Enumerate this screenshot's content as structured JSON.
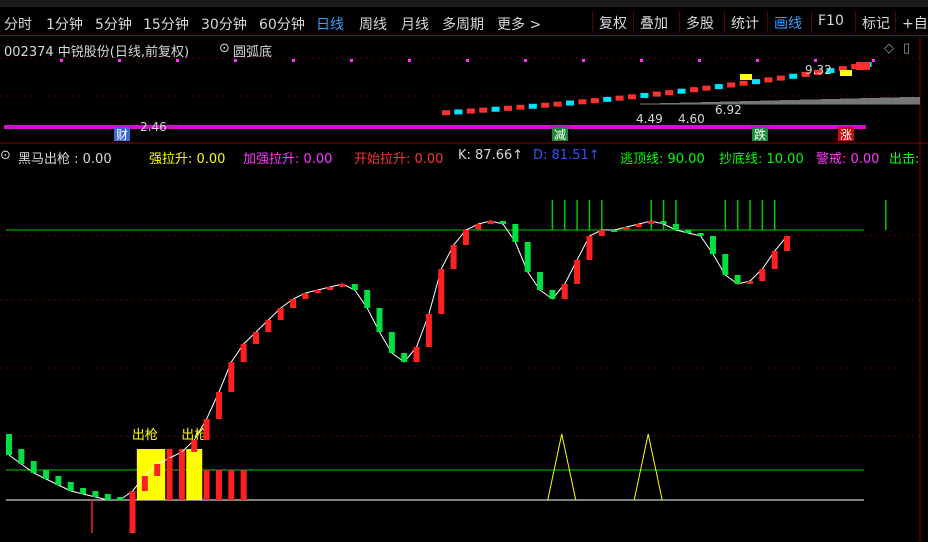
{
  "periods": [
    "分时",
    "1分钟",
    "5分钟",
    "15分钟",
    "30分钟",
    "60分钟",
    "日线",
    "周线",
    "月线",
    "多周期",
    "更多 >"
  ],
  "active_period": 6,
  "tools": [
    "复权",
    "叠加",
    "多股",
    "统计",
    "画线",
    "F10",
    "标记",
    "+自选"
  ],
  "active_tool": 4,
  "stock": {
    "code_name": "002374 中锐股份(日线,前复权)",
    "indicator_name": "圆弧底"
  },
  "main_chart": {
    "price_labels": [
      "9.32",
      "2.46",
      "4.49",
      "4.60",
      "6.92"
    ],
    "event_markers": [
      {
        "label": "财",
        "color": "#3a6ad8"
      },
      {
        "label": "减",
        "color": "#1e8a3a"
      },
      {
        "label": "跌",
        "color": "#1e8a3a"
      },
      {
        "label": "涨",
        "color": "#c01010"
      }
    ]
  },
  "indicator": {
    "name": "黑马出枪",
    "params": [
      {
        "label": "黑马出枪 : 0.00",
        "color": "#d8d8d8"
      },
      {
        "label": "强拉升: 0.00",
        "color": "#ffff00"
      },
      {
        "label": "加强拉升: 0.00",
        "color": "#ff33ff"
      },
      {
        "label": "开始拉升: 0.00",
        "color": "#ff3333"
      },
      {
        "label": "K: 87.66↑",
        "color": "#d8d8d8"
      },
      {
        "label": "D: 81.51↑",
        "color": "#3355ff"
      },
      {
        "label": "逃顶线: 90.00",
        "color": "#00ff00"
      },
      {
        "label": "抄底线: 10.00",
        "color": "#00ff00"
      },
      {
        "label": "警戒: 0.00",
        "color": "#ff33ff"
      },
      {
        "label": "出击:",
        "color": "#00ff00"
      }
    ],
    "signal_labels": [
      "出枪",
      "出枪"
    ]
  },
  "chart_data": {
    "type": "bar",
    "title": "黑马出枪",
    "reference_lines": {
      "逃顶线": 90,
      "抄底线": 10,
      "zero": 0
    },
    "k_series": [
      {
        "c": 15,
        "o": 22,
        "up": false
      },
      {
        "c": 12,
        "o": 17,
        "up": false
      },
      {
        "c": 9,
        "o": 13,
        "up": false
      },
      {
        "c": 7,
        "o": 10,
        "up": false
      },
      {
        "c": 5,
        "o": 8,
        "up": false
      },
      {
        "c": 3,
        "o": 6,
        "up": false
      },
      {
        "c": 2,
        "o": 4,
        "up": false
      },
      {
        "c": 1,
        "o": 3,
        "up": false
      },
      {
        "c": 0,
        "o": 2,
        "up": false
      },
      {
        "c": 0,
        "o": 1,
        "up": false
      },
      {
        "c": 3,
        "o": 0,
        "up": true
      },
      {
        "c": 8,
        "o": 3,
        "up": true
      },
      {
        "c": 12,
        "o": 8,
        "up": true
      },
      {
        "c": 14,
        "o": 12,
        "up": true
      },
      {
        "c": 16,
        "o": 14,
        "up": true
      },
      {
        "c": 20,
        "o": 16,
        "up": true
      },
      {
        "c": 27,
        "o": 20,
        "up": true
      },
      {
        "c": 36,
        "o": 27,
        "up": true
      },
      {
        "c": 46,
        "o": 36,
        "up": true
      },
      {
        "c": 52,
        "o": 46,
        "up": true
      },
      {
        "c": 56,
        "o": 52,
        "up": true
      },
      {
        "c": 60,
        "o": 56,
        "up": true
      },
      {
        "c": 64,
        "o": 60,
        "up": true
      },
      {
        "c": 67,
        "o": 64,
        "up": true
      },
      {
        "c": 69,
        "o": 67,
        "up": true
      },
      {
        "c": 70,
        "o": 69,
        "up": true
      },
      {
        "c": 71,
        "o": 70,
        "up": true
      },
      {
        "c": 72,
        "o": 71,
        "up": true
      },
      {
        "c": 70,
        "o": 72,
        "up": false
      },
      {
        "c": 64,
        "o": 70,
        "up": false
      },
      {
        "c": 56,
        "o": 64,
        "up": false
      },
      {
        "c": 49,
        "o": 56,
        "up": false
      },
      {
        "c": 46,
        "o": 49,
        "up": false
      },
      {
        "c": 51,
        "o": 46,
        "up": true
      },
      {
        "c": 62,
        "o": 51,
        "up": true
      },
      {
        "c": 77,
        "o": 62,
        "up": true
      },
      {
        "c": 85,
        "o": 77,
        "up": true
      },
      {
        "c": 90,
        "o": 85,
        "up": true
      },
      {
        "c": 92,
        "o": 90,
        "up": true
      },
      {
        "c": 93,
        "o": 92,
        "up": true
      },
      {
        "c": 92,
        "o": 93,
        "up": false
      },
      {
        "c": 86,
        "o": 92,
        "up": false
      },
      {
        "c": 76,
        "o": 86,
        "up": false
      },
      {
        "c": 70,
        "o": 76,
        "up": false
      },
      {
        "c": 67,
        "o": 70,
        "up": false
      },
      {
        "c": 72,
        "o": 67,
        "up": true
      },
      {
        "c": 80,
        "o": 72,
        "up": true
      },
      {
        "c": 88,
        "o": 80,
        "up": true
      },
      {
        "c": 90,
        "o": 88,
        "up": true
      },
      {
        "c": 90,
        "o": 90,
        "up": false
      },
      {
        "c": 91,
        "o": 90,
        "up": true
      },
      {
        "c": 92,
        "o": 91,
        "up": true
      },
      {
        "c": 93,
        "o": 92,
        "up": true
      },
      {
        "c": 92,
        "o": 93,
        "up": false
      },
      {
        "c": 90,
        "o": 92,
        "up": false
      },
      {
        "c": 89,
        "o": 90,
        "up": false
      },
      {
        "c": 88,
        "o": 89,
        "up": false
      },
      {
        "c": 82,
        "o": 88,
        "up": false
      },
      {
        "c": 75,
        "o": 82,
        "up": false
      },
      {
        "c": 72,
        "o": 75,
        "up": false
      },
      {
        "c": 73,
        "o": 72,
        "up": true
      },
      {
        "c": 77,
        "o": 73,
        "up": true
      },
      {
        "c": 83,
        "o": 77,
        "up": true
      },
      {
        "c": 88,
        "o": 83,
        "up": true
      }
    ],
    "signal_bars": [
      {
        "i": 10,
        "v": -11,
        "color": "#ff2020"
      },
      {
        "i": 11,
        "v": 17,
        "color": "#ffff00"
      },
      {
        "i": 12,
        "v": 17,
        "color": "#ffff00"
      },
      {
        "i": 13,
        "v": 17,
        "color": "#ff2020"
      },
      {
        "i": 14,
        "v": 17,
        "color": "#ff2020"
      },
      {
        "i": 15,
        "v": 17,
        "color": "#ffff00"
      },
      {
        "i": 16,
        "v": 10,
        "color": "#ff2020"
      },
      {
        "i": 17,
        "v": 10,
        "color": "#ff2020"
      },
      {
        "i": 18,
        "v": 10,
        "color": "#ff2020"
      },
      {
        "i": 19,
        "v": 10,
        "color": "#ff2020"
      }
    ],
    "signal_label_bars": [
      11,
      15
    ],
    "spikes": [
      {
        "i": 45,
        "v": 22
      },
      {
        "i": 52,
        "v": 22
      }
    ],
    "top_spikes": [
      44,
      45,
      46,
      47,
      48,
      52,
      53,
      54,
      58,
      59,
      60,
      61,
      62,
      71
    ]
  }
}
